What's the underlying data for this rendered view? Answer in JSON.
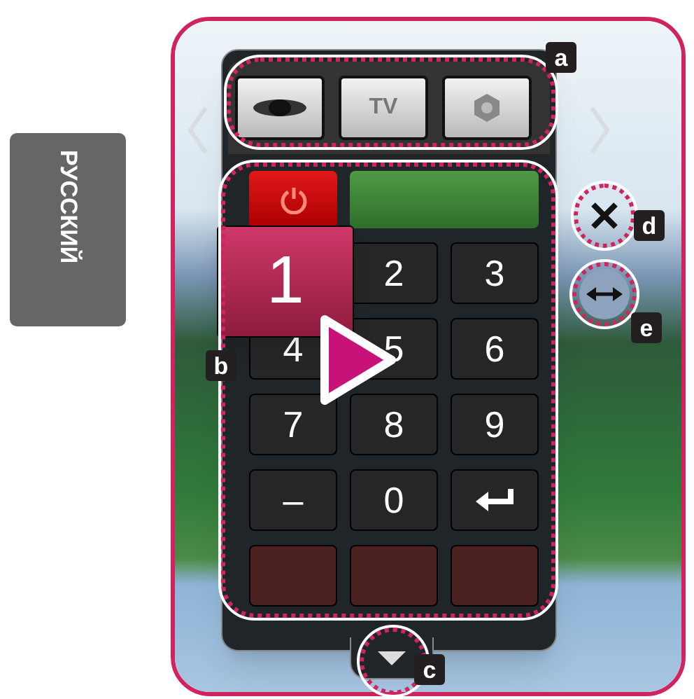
{
  "language_tab": {
    "label": "РУССКИЙ"
  },
  "top_bar": {
    "tv_label": "TV"
  },
  "keys": [
    {
      "kind": "digit",
      "label": "1",
      "selected": true
    },
    {
      "kind": "digit",
      "label": "2",
      "selected": false
    },
    {
      "kind": "digit",
      "label": "3",
      "selected": false
    },
    {
      "kind": "digit",
      "label": "4",
      "selected": false
    },
    {
      "kind": "digit",
      "label": "5",
      "selected": false
    },
    {
      "kind": "digit",
      "label": "6",
      "selected": false
    },
    {
      "kind": "digit",
      "label": "7",
      "selected": false
    },
    {
      "kind": "digit",
      "label": "8",
      "selected": false
    },
    {
      "kind": "digit",
      "label": "9",
      "selected": false
    },
    {
      "kind": "digit",
      "label": "–",
      "selected": false
    },
    {
      "kind": "digit",
      "label": "0",
      "selected": false
    },
    {
      "kind": "enter",
      "selected": false
    }
  ],
  "callouts": [
    {
      "label": "a"
    },
    {
      "label": "b"
    },
    {
      "label": "c"
    },
    {
      "label": "d"
    },
    {
      "label": "e"
    }
  ]
}
